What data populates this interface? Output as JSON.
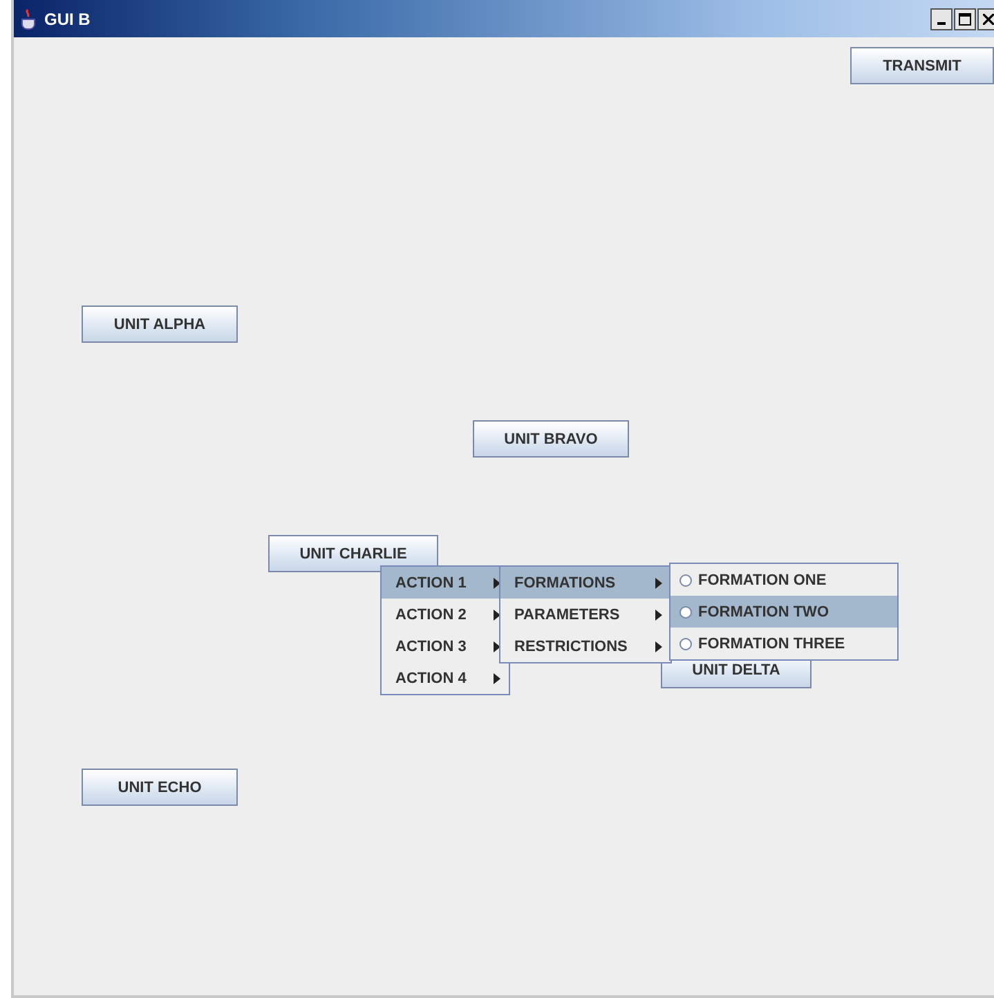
{
  "window": {
    "title": "GUI B"
  },
  "transmit_button": "TRANSMIT",
  "units": [
    "UNIT ALPHA",
    "UNIT BRAVO",
    "UNIT CHARLIE",
    "UNIT DELTA",
    "UNIT ECHO"
  ],
  "menus": [
    {
      "items": [
        {
          "label": "ACTION 1",
          "kind": "submenu",
          "selected": true
        },
        {
          "label": "ACTION 2",
          "kind": "submenu",
          "selected": false
        },
        {
          "label": "ACTION 3",
          "kind": "submenu",
          "selected": false
        },
        {
          "label": "ACTION 4",
          "kind": "submenu",
          "selected": false
        }
      ]
    },
    {
      "items": [
        {
          "label": "FORMATIONS",
          "kind": "submenu",
          "selected": true
        },
        {
          "label": "PARAMETERS",
          "kind": "submenu",
          "selected": false
        },
        {
          "label": "RESTRICTIONS",
          "kind": "submenu",
          "selected": false
        }
      ]
    },
    {
      "items": [
        {
          "label": "FORMATION ONE",
          "kind": "radio",
          "checked": false,
          "selected": false
        },
        {
          "label": "FORMATION TWO",
          "kind": "radio",
          "checked": false,
          "selected": true
        },
        {
          "label": "FORMATION THREE",
          "kind": "radio",
          "checked": false,
          "selected": false
        }
      ]
    }
  ]
}
